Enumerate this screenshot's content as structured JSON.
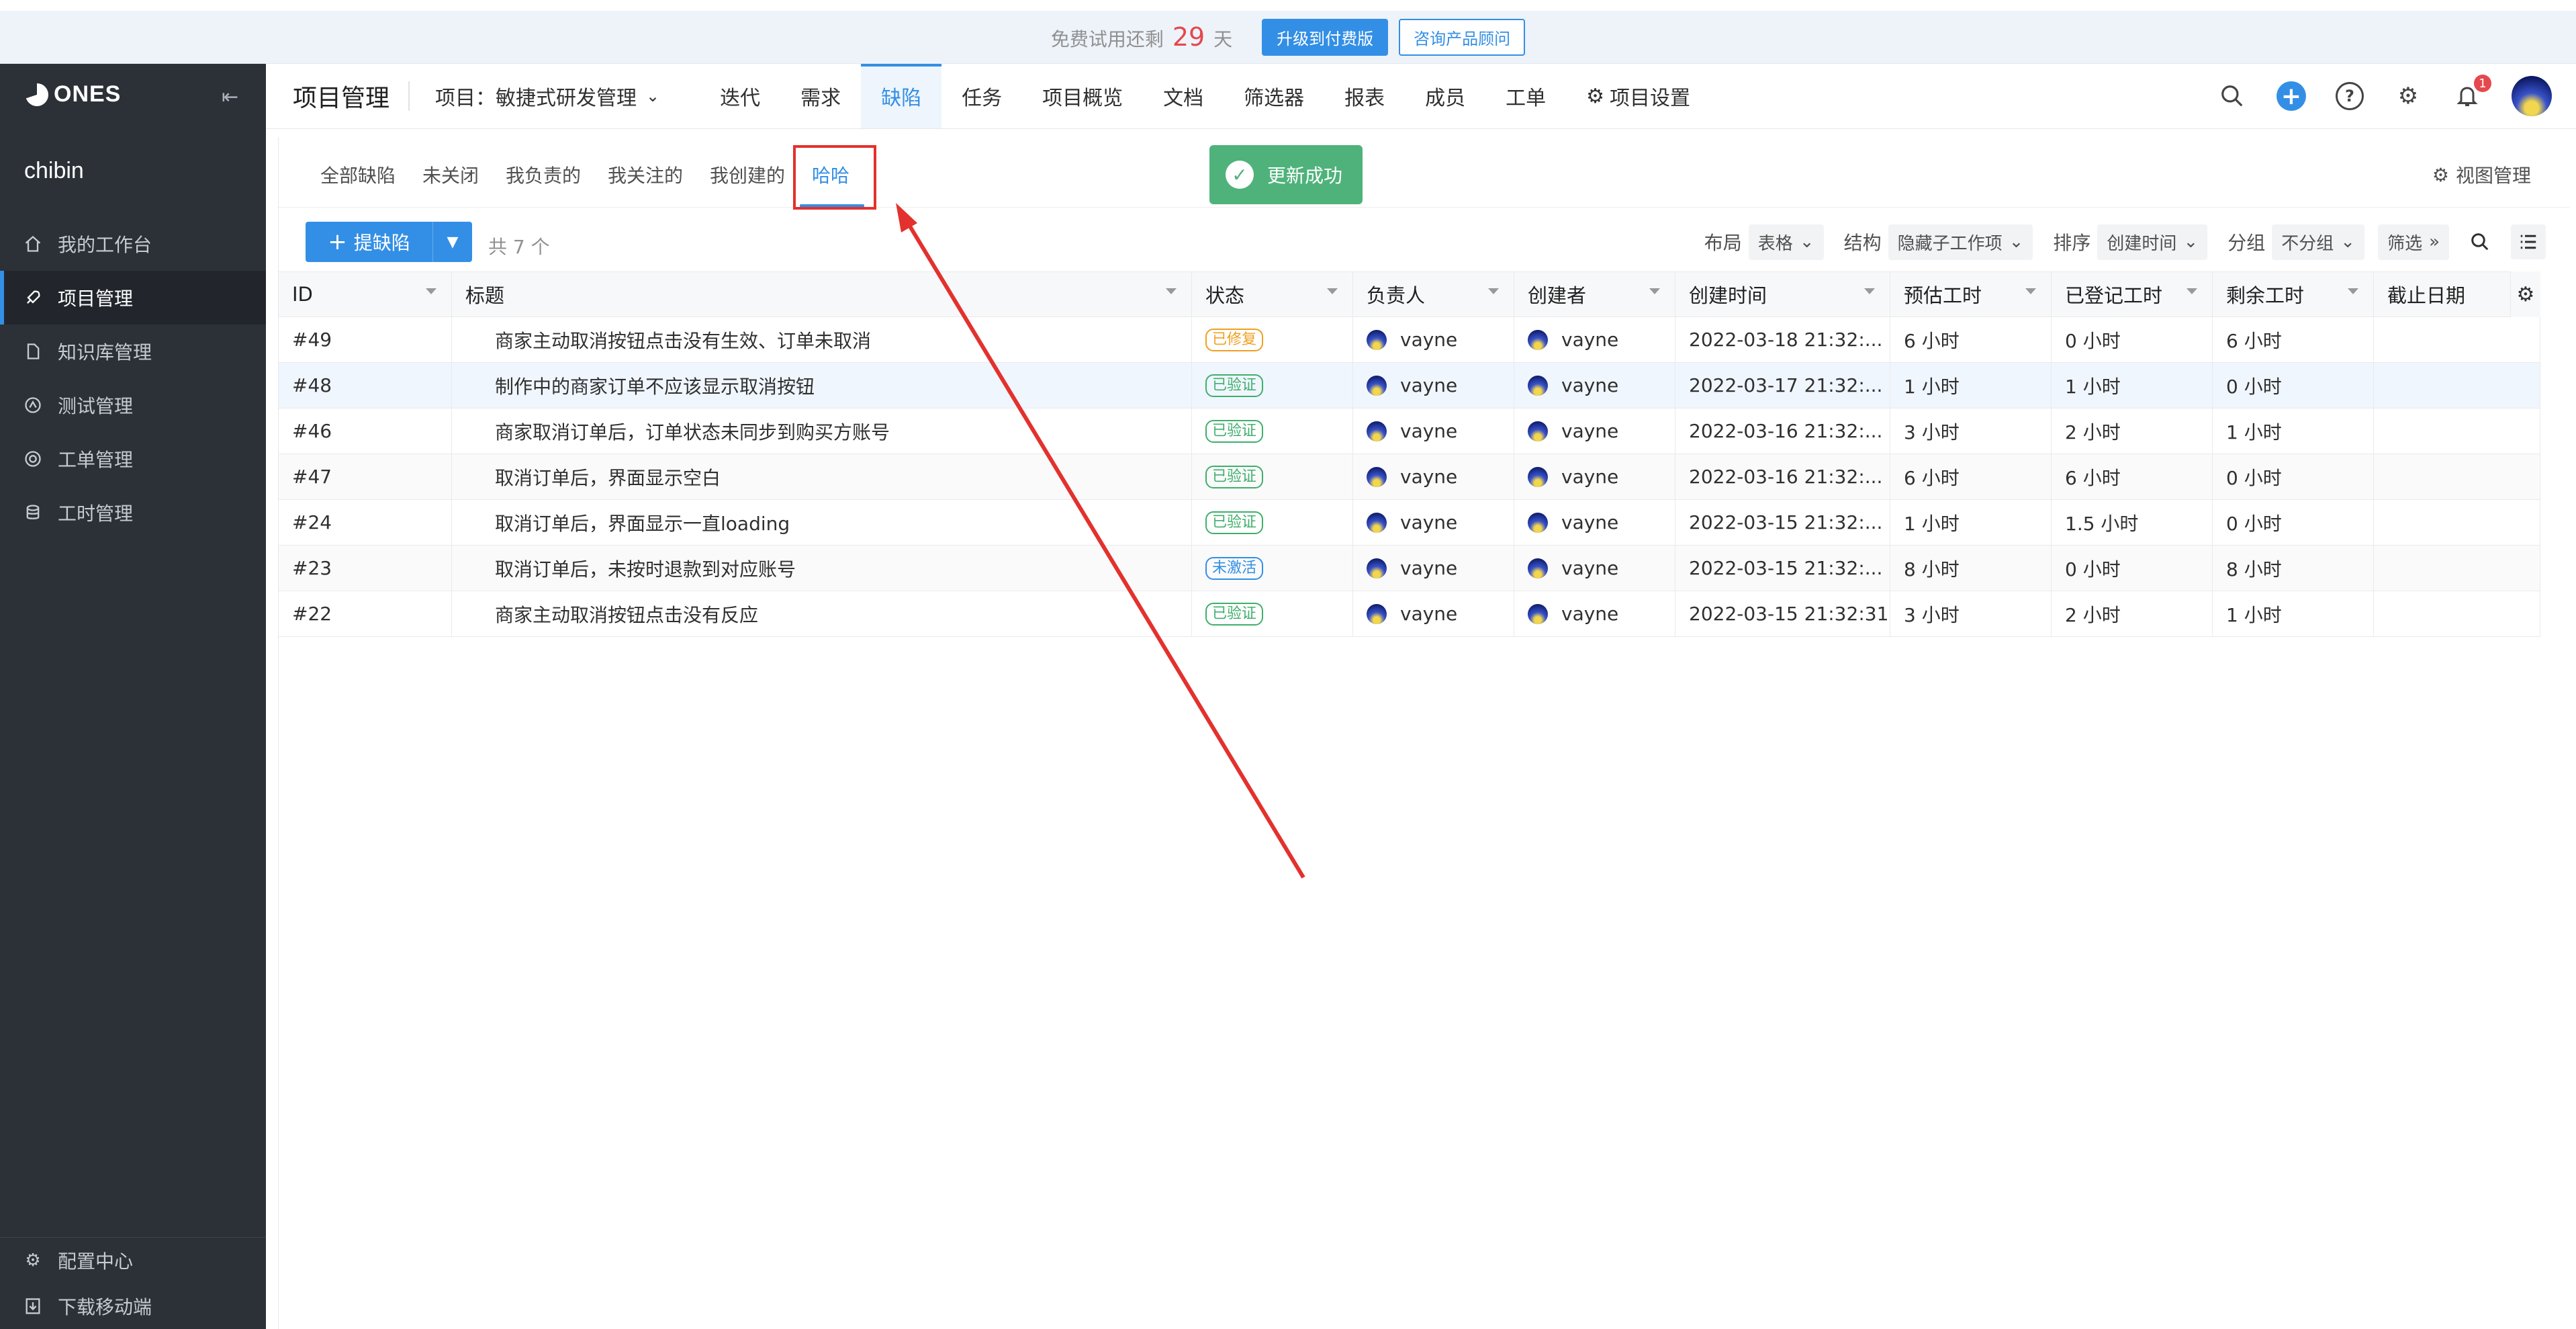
{
  "banner": {
    "trial_prefix": "免费试用还剩",
    "days_left": "29",
    "days_unit": "天",
    "upgrade_label": "升级到付费版",
    "consult_label": "咨询产品顾问"
  },
  "sidebar": {
    "logo": "ONES",
    "username": "chibin",
    "items": [
      {
        "label": "我的工作台",
        "icon": "home-icon"
      },
      {
        "label": "项目管理",
        "icon": "rocket-icon"
      },
      {
        "label": "知识库管理",
        "icon": "document-icon"
      },
      {
        "label": "测试管理",
        "icon": "test-icon"
      },
      {
        "label": "工单管理",
        "icon": "ticket-icon"
      },
      {
        "label": "工时管理",
        "icon": "database-icon"
      }
    ],
    "bottom": [
      {
        "label": "配置中心",
        "icon": "gear-icon"
      },
      {
        "label": "下载移动端",
        "icon": "download-icon"
      }
    ]
  },
  "topnav": {
    "title": "项目管理",
    "project": "项目：敏捷式研发管理",
    "tabs": [
      "迭代",
      "需求",
      "缺陷",
      "任务",
      "项目概览",
      "文档",
      "筛选器",
      "报表",
      "成员",
      "工单",
      "项目设置"
    ],
    "active_tab": "缺陷",
    "notification_count": "1"
  },
  "view_tabs": {
    "items": [
      "全部缺陷",
      "未关闭",
      "我负责的",
      "我关注的",
      "我创建的",
      "哈哈"
    ],
    "active": "哈哈",
    "manage_label": "视图管理"
  },
  "toast": "更新成功",
  "toolbar": {
    "add_label": "提缺陷",
    "total": "共 7 个",
    "layout_label": "布局",
    "layout_value": "表格",
    "structure_label": "结构",
    "structure_value": "隐藏子工作项",
    "sort_label": "排序",
    "sort_value": "创建时间",
    "group_label": "分组",
    "group_value": "不分组",
    "filter_label": "筛选"
  },
  "table": {
    "columns": [
      "ID",
      "标题",
      "状态",
      "负责人",
      "创建者",
      "创建时间",
      "预估工时",
      "已登记工时",
      "剩余工时",
      "截止日期"
    ],
    "rows": [
      {
        "id": "#49",
        "title": "商家主动取消按钮点击没有生效、订单未取消",
        "status": "已修复",
        "status_color": "#f0a020",
        "owner": "vayne",
        "creator": "vayne",
        "created": "2022-03-18 21:32:...",
        "estimate": "6 小时",
        "logged": "0 小时",
        "remaining": "6 小时",
        "due": ""
      },
      {
        "id": "#48",
        "title": "制作中的商家订单不应该显示取消按钮",
        "status": "已验证",
        "status_color": "#3faf6c",
        "owner": "vayne",
        "creator": "vayne",
        "created": "2022-03-17 21:32:...",
        "estimate": "1 小时",
        "logged": "1 小时",
        "remaining": "0 小时",
        "due": ""
      },
      {
        "id": "#46",
        "title": "商家取消订单后，订单状态未同步到购买方账号",
        "status": "已验证",
        "status_color": "#3faf6c",
        "owner": "vayne",
        "creator": "vayne",
        "created": "2022-03-16 21:32:...",
        "estimate": "3 小时",
        "logged": "2 小时",
        "remaining": "1 小时",
        "due": ""
      },
      {
        "id": "#47",
        "title": "取消订单后，界面显示空白",
        "status": "已验证",
        "status_color": "#3faf6c",
        "owner": "vayne",
        "creator": "vayne",
        "created": "2022-03-16 21:32:...",
        "estimate": "6 小时",
        "logged": "6 小时",
        "remaining": "0 小时",
        "due": ""
      },
      {
        "id": "#24",
        "title": "取消订单后，界面显示一直loading",
        "status": "已验证",
        "status_color": "#3faf6c",
        "owner": "vayne",
        "creator": "vayne",
        "created": "2022-03-15 21:32:...",
        "estimate": "1 小时",
        "logged": "1.5 小时",
        "remaining": "0 小时",
        "due": ""
      },
      {
        "id": "#23",
        "title": "取消订单后，未按时退款到对应账号",
        "status": "未激活",
        "status_color": "#338fe5",
        "owner": "vayne",
        "creator": "vayne",
        "created": "2022-03-15 21:32:...",
        "estimate": "8 小时",
        "logged": "0 小时",
        "remaining": "8 小时",
        "due": ""
      },
      {
        "id": "#22",
        "title": "商家主动取消按钮点击没有反应",
        "status": "已验证",
        "status_color": "#3faf6c",
        "owner": "vayne",
        "creator": "vayne",
        "created": "2022-03-15 21:32:31",
        "estimate": "3 小时",
        "logged": "2 小时",
        "remaining": "1 小时",
        "due": ""
      }
    ]
  },
  "colors": {
    "accent": "#338fe5",
    "sidebar_bg": "#2c3138",
    "toast_bg": "#4fb27b",
    "annotation_red": "#e3312d"
  }
}
